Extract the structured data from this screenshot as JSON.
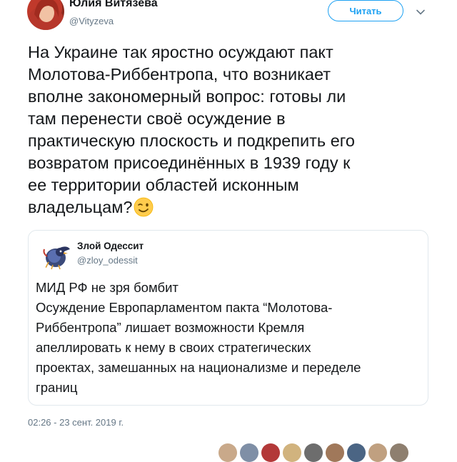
{
  "author": {
    "name": "Юлия Витязева",
    "handle": "@Vityzeva"
  },
  "follow_button": {
    "label": "Читать"
  },
  "icons": {
    "caret": "chevron-down-icon",
    "emoji": "winking-face-emoji"
  },
  "tweet": {
    "lines": [
      "На Украине так яростно осуждают пакт",
      "Молотова-Риббентропа, что возникает",
      "вполне закономерный вопрос: готовы ли",
      "там перенести своё осуждение в",
      "практическую плоскость и подкрепить его",
      "возвратом присоединённых в 1939 году к",
      "ее территории областей исконным",
      "владельцам?"
    ]
  },
  "quoted_tweet": {
    "name": "Злой Одессит",
    "handle": "@zloy_odessit",
    "lines": [
      "МИД РФ не зря бомбит",
      "Осуждение Европарламентом пакта “Молотова-",
      "Риббентропа” лишает возможности Кремля",
      "апеллировать к нему в своих стратегических",
      "проектах, замешанных на национализме и переделе",
      "границ"
    ]
  },
  "timestamp": "02:26 - 23 сент. 2019 г.",
  "colors": {
    "accent": "#1da1f2",
    "text": "#14171a",
    "secondary_text": "#657786",
    "border": "#e1e8ed"
  }
}
